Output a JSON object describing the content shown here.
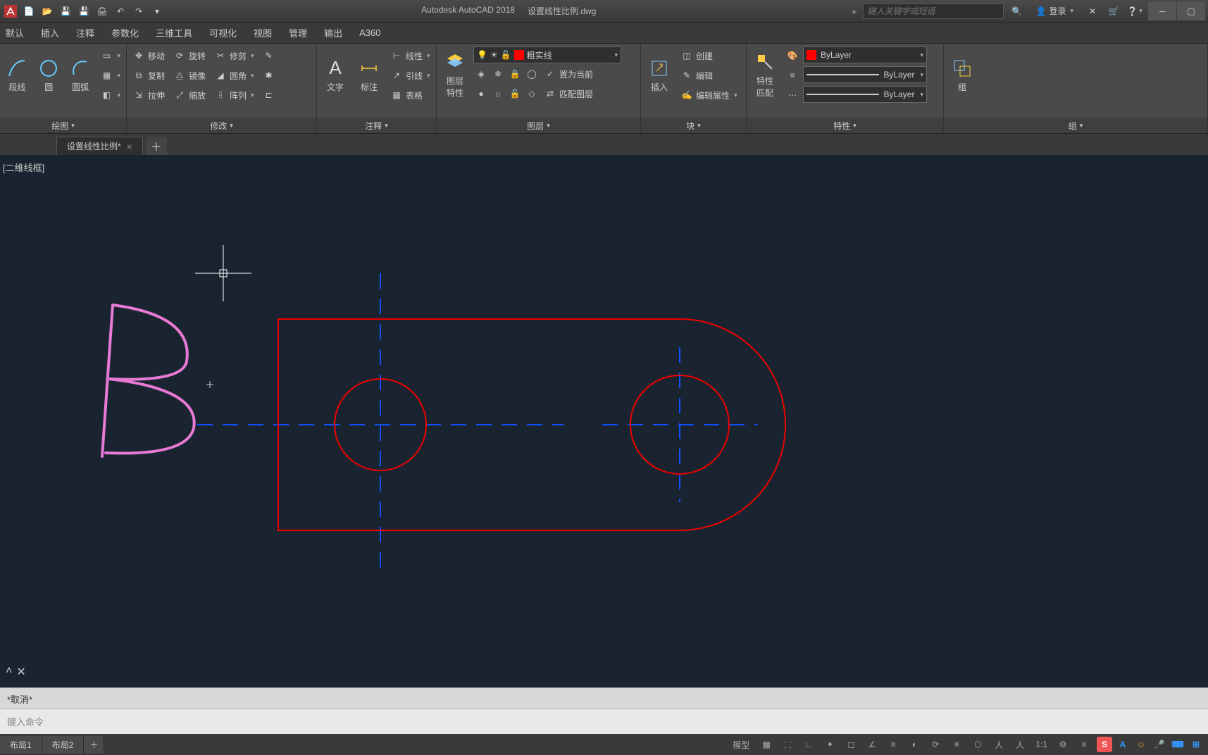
{
  "title": {
    "app": "Autodesk AutoCAD 2018",
    "file": "设置线性比例.dwg"
  },
  "search": {
    "placeholder": "键入关键字或短语"
  },
  "login": "登录",
  "menubar": [
    "默认",
    "插入",
    "注释",
    "参数化",
    "三维工具",
    "可视化",
    "视图",
    "管理",
    "输出",
    "A360"
  ],
  "ribbon": {
    "draw": {
      "label": "绘图",
      "line_dd": "段线",
      "circle": "圆",
      "arc": "圆弧"
    },
    "modify": {
      "label": "修改",
      "move": "移动",
      "rotate": "旋转",
      "trim": "修剪",
      "copy": "复制",
      "mirror": "镜像",
      "fillet": "圆角",
      "stretch": "拉伸",
      "scale": "缩放",
      "array": "阵列"
    },
    "annotate": {
      "label": "注释",
      "text": "文字",
      "dim": "标注",
      "linear": "线性",
      "leader": "引线",
      "table": "表格"
    },
    "layers": {
      "label": "图层",
      "props": "图层\n特性",
      "current": "粗实线",
      "setcur": "置为当前",
      "match": "匹配图层"
    },
    "block": {
      "label": "块",
      "insert": "插入",
      "create": "创建",
      "edit": "编辑",
      "editattr": "编辑属性"
    },
    "props": {
      "label": "特性",
      "match": "特性\n匹配",
      "color": "ByLayer",
      "ltype": "ByLayer",
      "lweight": "ByLayer"
    },
    "group": {
      "label": "组",
      "group": "组"
    }
  },
  "filetab": {
    "name": "设置线性比例*"
  },
  "viewlabel": "[二维线框]",
  "cmd": {
    "hist": "*取消*",
    "prompt": "键入命令"
  },
  "layouts": [
    "布局1",
    "布局2"
  ],
  "status": {
    "model": "模型",
    "scale": "1:1"
  },
  "ime": {
    "s": "S",
    "a": "A"
  }
}
